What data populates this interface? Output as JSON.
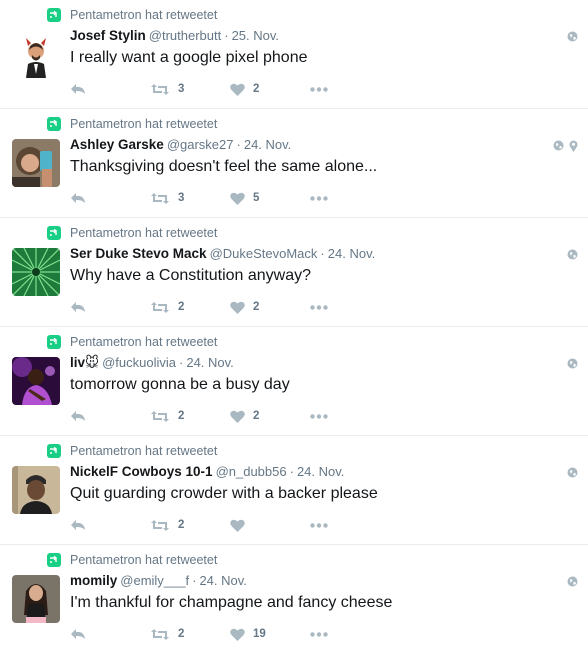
{
  "retweet_label": "Pentametron hat retweetet",
  "colors": {
    "retweet_green": "#19cf86",
    "icon_gray": "#aab8c2",
    "meta_gray": "#657786"
  },
  "tweets": [
    {
      "name": "Josef Stylin",
      "screen_name": "@trutherbutt",
      "time": "25. Nov.",
      "text": "I really want a google pixel phone",
      "retweets": "3",
      "likes": "2",
      "meta_icons": [
        "globe-icon"
      ]
    },
    {
      "name": "Ashley Garske",
      "screen_name": "@garske27",
      "time": "24. Nov.",
      "text": "Thanksgiving doesn't feel the same alone...",
      "retweets": "3",
      "likes": "5",
      "meta_icons": [
        "globe-icon",
        "location-pin-icon"
      ]
    },
    {
      "name": "Ser Duke Stevo Mack",
      "screen_name": "@DukeStevoMack",
      "time": "24. Nov.",
      "text": "Why have a Constitution anyway?",
      "retweets": "2",
      "likes": "2",
      "meta_icons": [
        "globe-icon"
      ]
    },
    {
      "name": "liv🐭",
      "screen_name": "@fuckuolivia",
      "time": "24. Nov.",
      "text": "tomorrow gonna be a busy day",
      "retweets": "2",
      "likes": "2",
      "meta_icons": [
        "globe-icon"
      ]
    },
    {
      "name": "NickelF Cowboys 10-1",
      "screen_name": "@n_dubb56",
      "time": "24. Nov.",
      "text": "Quit guarding crowder with a backer please",
      "retweets": "2",
      "likes": "",
      "meta_icons": [
        "globe-icon"
      ]
    },
    {
      "name": "momily",
      "screen_name": "@emily___f",
      "time": "24. Nov.",
      "text": "I'm thankful for champagne and fancy cheese",
      "retweets": "2",
      "likes": "19",
      "meta_icons": [
        "globe-icon"
      ]
    }
  ]
}
